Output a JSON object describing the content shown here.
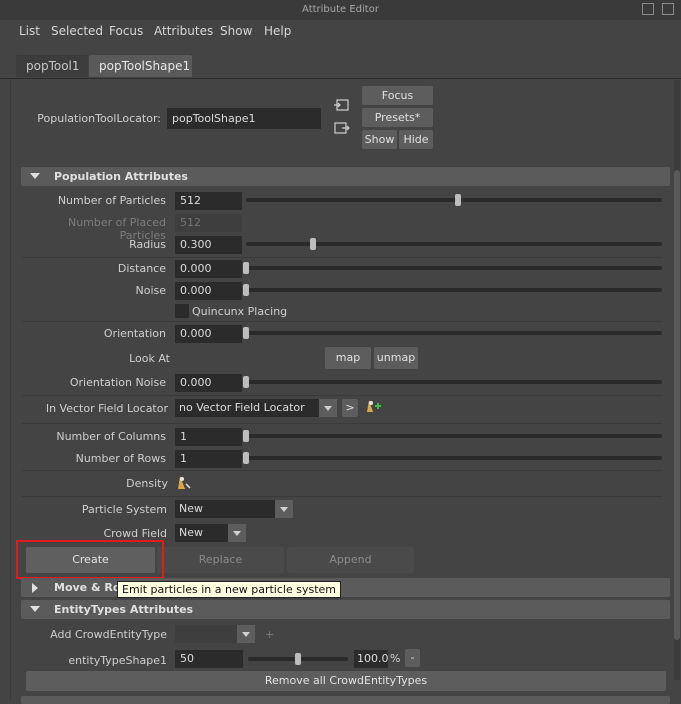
{
  "window": {
    "title": "Attribute Editor"
  },
  "menu": [
    "List",
    "Selected",
    "Focus",
    "Attributes",
    "Show",
    "Help"
  ],
  "tabs": [
    {
      "label": "popTool1"
    },
    {
      "label": "popToolShape1"
    }
  ],
  "header": {
    "locator_label": "PopulationToolLocator:",
    "locator_value": "popToolShape1",
    "focus": "Focus",
    "presets": "Presets*",
    "show": "Show",
    "hide": "Hide"
  },
  "population": {
    "title": "Population Attributes",
    "num_particles": {
      "label": "Number of Particles",
      "value": "512",
      "slider": 0.51
    },
    "num_placed": {
      "label": "Number of Placed Particles",
      "value": "512"
    },
    "radius": {
      "label": "Radius",
      "value": "0.300",
      "slider": 0.16
    },
    "distance": {
      "label": "Distance",
      "value": "0.000",
      "slider": 0.0
    },
    "noise": {
      "label": "Noise",
      "value": "0.000",
      "slider": 0.0
    },
    "quincunx": {
      "label": "Quincunx Placing",
      "checked": false
    },
    "orientation": {
      "label": "Orientation",
      "value": "0.000",
      "slider": 0.0
    },
    "look_at": {
      "label": "Look At",
      "map": "map",
      "unmap": "unmap"
    },
    "orientation_noise": {
      "label": "Orientation Noise",
      "value": "0.000",
      "slider": 0.0
    },
    "vector_field": {
      "label": "In Vector Field Locator",
      "value": "no Vector Field Locator",
      "goto": ">"
    },
    "columns": {
      "label": "Number of Columns",
      "value": "1",
      "slider": 0.0
    },
    "rows": {
      "label": "Number of Rows",
      "value": "1",
      "slider": 0.0
    },
    "density": {
      "label": "Density"
    },
    "particle_system": {
      "label": "Particle System",
      "value": "New"
    },
    "crowd_field": {
      "label": "Crowd Field",
      "value": "New"
    },
    "buttons": {
      "create": "Create",
      "replace": "Replace",
      "append": "Append"
    }
  },
  "tooltip": "Emit particles in a new particle system",
  "move_section": {
    "title": "Move & Ro"
  },
  "entity": {
    "title": "EntityTypes Attributes",
    "add_label": "Add CrowdEntityType",
    "add_plus": "+",
    "shape_label": "entityTypeShape1",
    "shape_value": "50",
    "shape_slider": 0.5,
    "percent_value": "100.0",
    "percent_unit": "%",
    "minus": "-",
    "remove_all": "Remove all CrowdEntityTypes"
  },
  "colors": {
    "highlight": "#e01b1b",
    "tooltip_bg": "#ffffe1"
  }
}
